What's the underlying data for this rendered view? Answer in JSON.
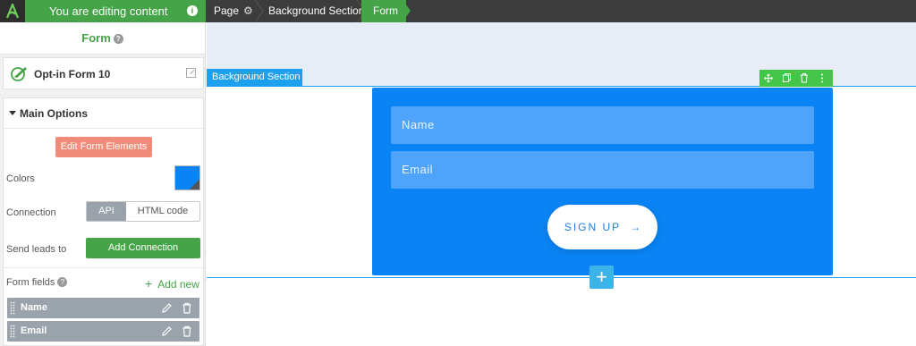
{
  "topbar": {
    "editing_label": "You are editing content",
    "info": "i",
    "breadcrumbs": {
      "page": "Page",
      "background_section": "Background Section",
      "form": "Form"
    }
  },
  "sidebar": {
    "title": "Form",
    "help": "?",
    "element_name": "Opt-in Form 10",
    "main_options": {
      "title": "Main Options",
      "edit_elements_label": "Edit Form Elements",
      "colors_label": "Colors",
      "color_value": "#0a84f5",
      "connection_label": "Connection",
      "connection_options": [
        "API",
        "HTML code"
      ],
      "connection_selected": "API",
      "send_leads_label": "Send leads to",
      "add_connection_label": "Add Connection",
      "form_fields_label": "Form fields",
      "add_new_label": "Add new",
      "fields": [
        {
          "name": "Name"
        },
        {
          "name": "Email"
        }
      ]
    }
  },
  "canvas": {
    "section_tag": "Background Section",
    "form": {
      "name_placeholder": "Name",
      "email_placeholder": "Email",
      "submit_label": "SIGN UP",
      "submit_arrow": "→"
    },
    "add_symbol": "+"
  },
  "colors": {
    "green": "#45a348",
    "blue": "#0a84f5",
    "section_blue": "#1da1ef",
    "salmon": "#f08c79"
  }
}
